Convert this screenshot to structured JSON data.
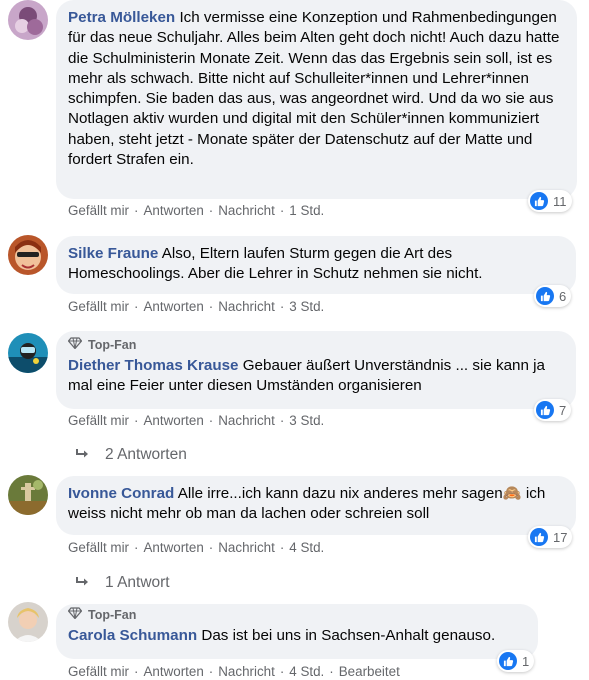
{
  "comments": [
    {
      "name": "Petra Mölleken",
      "text": "Ich vermisse eine Konzeption und Rahmenbedingungen für das neue Schuljahr. Alles beim Alten geht doch nicht! Auch dazu hatte die Schulministerin Monate Zeit. Wenn das das Ergebnis sein soll, ist es mehr als schwach. Bitte nicht auf Schulleiter*innen und Lehrer*innen schimpfen. Sie baden das aus, was angeordnet wird. Und da wo sie aus Notlagen aktiv wurden und digital mit den Schüler*innen kommuniziert haben, steht jetzt - Monate später der Datenschutz auf der Matte und fordert Strafen ein.",
      "like": "Gefällt mir",
      "reply": "Antworten",
      "message": "Nachricht",
      "time": "1 Std.",
      "reactions": "11"
    },
    {
      "name": "Silke Fraune",
      "text": "Also, Eltern laufen Sturm gegen die Art des Homeschoolings. Aber die Lehrer in Schutz nehmen sie nicht.",
      "like": "Gefällt mir",
      "reply": "Antworten",
      "message": "Nachricht",
      "time": "3 Std.",
      "reactions": "6"
    },
    {
      "badge": "Top-Fan",
      "name": "Diether Thomas Krause",
      "text": "Gebauer äußert Unverständnis ... sie kann ja mal eine Feier unter diesen Umständen organisieren",
      "like": "Gefällt mir",
      "reply": "Antworten",
      "message": "Nachricht",
      "time": "3 Std.",
      "reactions": "7",
      "replies": "2 Antworten"
    },
    {
      "name": "Ivonne Conrad",
      "text": "Alle irre...ich kann dazu nix anderes mehr sagen",
      "emoji": "🙈",
      "text2": "ich weiss nicht mehr ob man da lachen oder schreien soll",
      "like": "Gefällt mir",
      "reply": "Antworten",
      "message": "Nachricht",
      "time": "4 Std.",
      "reactions": "17",
      "replies": "1 Antwort"
    },
    {
      "badge": "Top-Fan",
      "name": "Carola Schumann",
      "text": "Das ist bei uns in Sachsen-Anhalt genauso.",
      "like": "Gefällt mir",
      "reply": "Antworten",
      "message": "Nachricht",
      "time": "4 Std.",
      "edited": "Bearbeitet",
      "reactions": "1"
    }
  ],
  "separator": "·",
  "colors": {
    "name": "#385898",
    "bubble": "#f0f2f5",
    "meta": "#65676b",
    "like": "#1877f2"
  },
  "icons": {
    "like": "thumbs-up-icon",
    "badge": "diamond-icon",
    "reply": "reply-arrow-icon"
  }
}
